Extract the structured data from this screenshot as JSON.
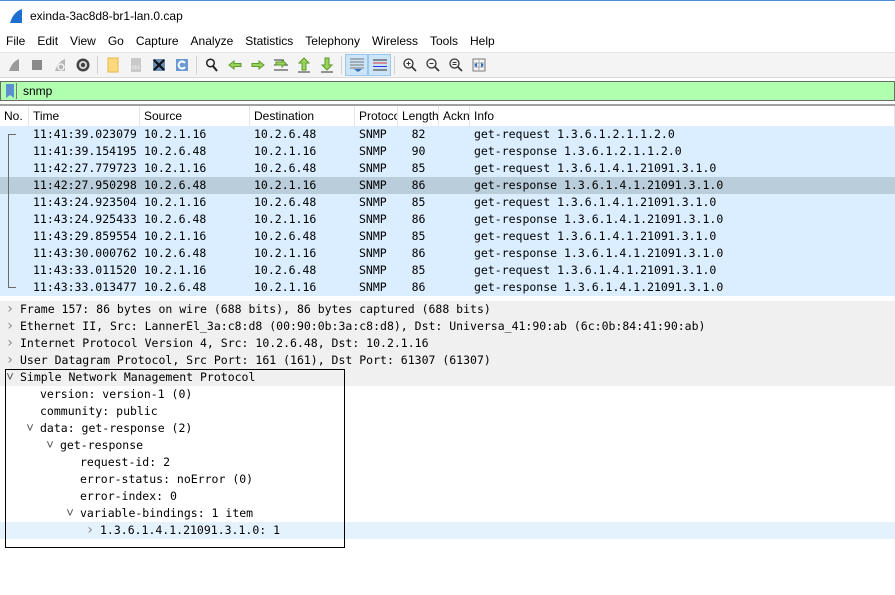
{
  "window": {
    "title": "exinda-3ac8d8-br1-lan.0.cap",
    "app_icon": "wireshark-fin-icon"
  },
  "menu": [
    "File",
    "Edit",
    "View",
    "Go",
    "Capture",
    "Analyze",
    "Statistics",
    "Telephony",
    "Wireless",
    "Tools",
    "Help"
  ],
  "toolbar": {
    "buttons": [
      {
        "name": "start-capture-icon"
      },
      {
        "name": "stop-capture-icon"
      },
      {
        "name": "restart-capture-icon"
      },
      {
        "name": "capture-options-icon"
      },
      {
        "name": "open-file-icon"
      },
      {
        "name": "save-file-icon"
      },
      {
        "name": "close-file-icon"
      },
      {
        "name": "reload-file-icon"
      },
      {
        "name": "find-packet-icon"
      },
      {
        "name": "go-back-icon"
      },
      {
        "name": "go-forward-icon"
      },
      {
        "name": "go-to-packet-icon"
      },
      {
        "name": "go-first-packet-icon"
      },
      {
        "name": "go-last-packet-icon"
      },
      {
        "name": "auto-scroll-icon",
        "active": true
      },
      {
        "name": "colorize-icon",
        "active": true
      },
      {
        "name": "zoom-in-icon"
      },
      {
        "name": "zoom-out-icon"
      },
      {
        "name": "zoom-normal-icon"
      },
      {
        "name": "resize-columns-icon"
      }
    ]
  },
  "filter": {
    "value": "snmp",
    "bg_color": "#afffaf"
  },
  "packet_list": {
    "columns": [
      "No.",
      "Time",
      "Source",
      "Destination",
      "Protoco",
      "Length",
      "Ackn",
      "Info"
    ],
    "rows": [
      {
        "no": "",
        "time": "11:41:39.023079",
        "source": "10.2.1.16",
        "destination": "10.2.6.48",
        "protocol": "SNMP",
        "length": "82",
        "ack": "",
        "info": "get-request 1.3.6.1.2.1.1.2.0"
      },
      {
        "no": "",
        "time": "11:41:39.154195",
        "source": "10.2.6.48",
        "destination": "10.2.1.16",
        "protocol": "SNMP",
        "length": "90",
        "ack": "",
        "info": "get-response 1.3.6.1.2.1.1.2.0"
      },
      {
        "no": "",
        "time": "11:42:27.779723",
        "source": "10.2.1.16",
        "destination": "10.2.6.48",
        "protocol": "SNMP",
        "length": "85",
        "ack": "",
        "info": "get-request 1.3.6.1.4.1.21091.3.1.0"
      },
      {
        "no": "",
        "time": "11:42:27.950298",
        "source": "10.2.6.48",
        "destination": "10.2.1.16",
        "protocol": "SNMP",
        "length": "86",
        "ack": "",
        "info": "get-response 1.3.6.1.4.1.21091.3.1.0",
        "selected": true
      },
      {
        "no": "",
        "time": "11:43:24.923504",
        "source": "10.2.1.16",
        "destination": "10.2.6.48",
        "protocol": "SNMP",
        "length": "85",
        "ack": "",
        "info": "get-request 1.3.6.1.4.1.21091.3.1.0"
      },
      {
        "no": "",
        "time": "11:43:24.925433",
        "source": "10.2.6.48",
        "destination": "10.2.1.16",
        "protocol": "SNMP",
        "length": "86",
        "ack": "",
        "info": "get-response 1.3.6.1.4.1.21091.3.1.0"
      },
      {
        "no": "",
        "time": "11:43:29.859554",
        "source": "10.2.1.16",
        "destination": "10.2.6.48",
        "protocol": "SNMP",
        "length": "85",
        "ack": "",
        "info": "get-request 1.3.6.1.4.1.21091.3.1.0"
      },
      {
        "no": "",
        "time": "11:43:30.000762",
        "source": "10.2.6.48",
        "destination": "10.2.1.16",
        "protocol": "SNMP",
        "length": "86",
        "ack": "",
        "info": "get-response 1.3.6.1.4.1.21091.3.1.0"
      },
      {
        "no": "",
        "time": "11:43:33.011520",
        "source": "10.2.1.16",
        "destination": "10.2.6.48",
        "protocol": "SNMP",
        "length": "85",
        "ack": "",
        "info": "get-request 1.3.6.1.4.1.21091.3.1.0"
      },
      {
        "no": "",
        "time": "11:43:33.013477",
        "source": "10.2.6.48",
        "destination": "10.2.1.16",
        "protocol": "SNMP",
        "length": "86",
        "ack": "",
        "info": "get-response 1.3.6.1.4.1.21091.3.1.0"
      }
    ],
    "row_color": "#daeeff",
    "selected_color": "#b9cddb"
  },
  "details": {
    "rows": [
      {
        "level": 0,
        "expander": "collapsed",
        "text": "Frame 157: 86 bytes on wire (688 bits), 86 bytes captured (688 bits)",
        "style": "grey"
      },
      {
        "level": 0,
        "expander": "collapsed",
        "text": "Ethernet II, Src: LannerEl_3a:c8:d8 (00:90:0b:3a:c8:d8), Dst: Universa_41:90:ab (6c:0b:84:41:90:ab)",
        "style": "grey"
      },
      {
        "level": 0,
        "expander": "collapsed",
        "text": "Internet Protocol Version 4, Src: 10.2.6.48, Dst: 10.2.1.16",
        "style": "grey"
      },
      {
        "level": 0,
        "expander": "collapsed",
        "text": "User Datagram Protocol, Src Port: 161 (161), Dst Port: 61307 (61307)",
        "style": "grey"
      },
      {
        "level": 0,
        "expander": "expanded",
        "text": "Simple Network Management Protocol",
        "style": "grey"
      },
      {
        "level": 1,
        "expander": "none",
        "text": "version: version-1 (0)"
      },
      {
        "level": 1,
        "expander": "none",
        "text": "community: public"
      },
      {
        "level": 1,
        "expander": "expanded",
        "text": "data: get-response (2)"
      },
      {
        "level": 2,
        "expander": "expanded",
        "text": "get-response"
      },
      {
        "level": 3,
        "expander": "none",
        "text": "request-id: 2"
      },
      {
        "level": 3,
        "expander": "none",
        "text": "error-status: noError (0)"
      },
      {
        "level": 3,
        "expander": "none",
        "text": "error-index: 0"
      },
      {
        "level": 3,
        "expander": "expanded",
        "text": "variable-bindings: 1 item"
      },
      {
        "level": 4,
        "expander": "collapsed",
        "text": "1.3.6.1.4.1.21091.3.1.0: 1",
        "style": "hl"
      }
    ]
  }
}
